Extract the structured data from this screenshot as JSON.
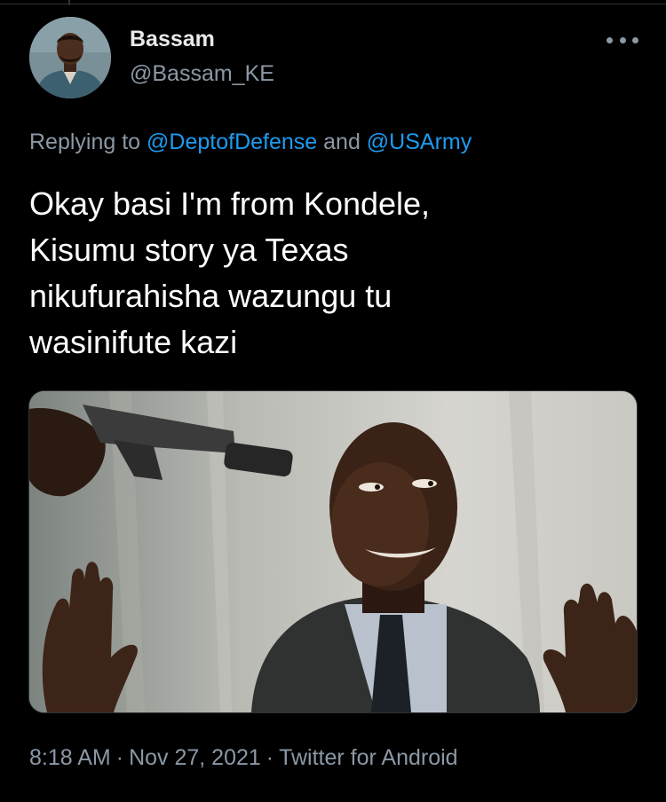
{
  "tweet": {
    "author": {
      "display_name": "Bassam",
      "handle": "@Bassam_KE"
    },
    "more_icon": "more-horizontal-icon",
    "reply_context": {
      "prefix": "Replying to ",
      "mention_1": "@DeptofDefense",
      "conjunction": " and ",
      "mention_2": "@USArmy"
    },
    "text_lines": [
      "Okay basi I'm from Kondele,",
      "Kisumu story ya Texas",
      "nikufurahisha wazungu tu",
      "wasinifute kazi"
    ],
    "media": {
      "type": "photo",
      "subject": "man in suit with hands raised, a pistol with silencer pointed at his head"
    },
    "meta": {
      "time": "8:18 AM",
      "separator": "·",
      "date": "Nov 27, 2021",
      "source": "Twitter for Android"
    }
  },
  "colors": {
    "background": "#000000",
    "primary_text": "#e7e9ea",
    "secondary_text": "#8b98a5",
    "link": "#1d9bf0",
    "border": "#2f3336"
  }
}
